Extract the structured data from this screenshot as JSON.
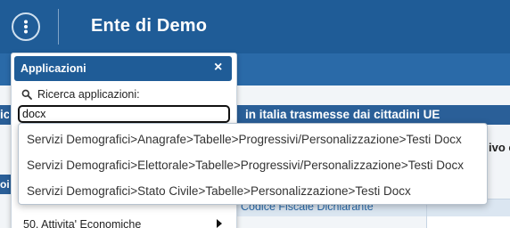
{
  "header": {
    "app_title": "Ente di Demo",
    "menu_icon": "vertical-dots-icon"
  },
  "background": {
    "form_bar_text": "in italia trasmesse dai cittadini UE",
    "form_bar_left_stub": "ici",
    "right_peek": "ivo c",
    "left_peek_lower": "oi",
    "cf_label": "Codice Fiscale Dichiarante"
  },
  "apps_panel": {
    "title": "Applicazioni",
    "close_label": "×",
    "search_label": "Ricerca applicazioni:",
    "search_icon": "search-icon",
    "search_value": "docx",
    "menu_item_50": "50. Attivita' Economiche"
  },
  "results": [
    "Servizi Demografici>Anagrafe>Tabelle>Progressivi/Personalizzazione>Testi Docx",
    "Servizi Demografici>Elettorale>Tabelle>Progressivi/Personalizzazione>Testi Docx",
    "Servizi Demografici>Stato Civile>Tabelle>Personalizzazione>Testi Docx"
  ],
  "colors": {
    "header_blue": "#1f5c97",
    "strip_blue": "#2a6aa8",
    "panel_bg": "#ffffff"
  }
}
